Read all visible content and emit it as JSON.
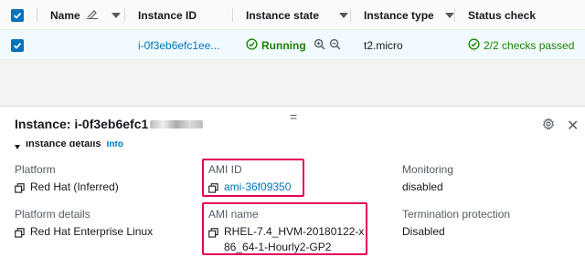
{
  "table": {
    "columns": {
      "name": "Name",
      "instance_id": "Instance ID",
      "instance_state": "Instance state",
      "instance_type": "Instance type",
      "status_check": "Status check"
    },
    "row": {
      "instance_id": "i-0f3eb6efc1ee...",
      "state": "Running",
      "type": "t2.micro",
      "status": "2/2 checks passed"
    }
  },
  "panel": {
    "title": "Instance: i-0f3eb6efc1",
    "drag_handle": "=",
    "section": "Instance details",
    "info_link": "Info",
    "close": "✕",
    "fields": {
      "platform_label": "Platform",
      "platform_value": "Red Hat (Inferred)",
      "ami_id_label": "AMI ID",
      "ami_id_value": "ami-36f09350",
      "monitoring_label": "Monitoring",
      "monitoring_value": "disabled",
      "platform_details_label": "Platform details",
      "platform_details_value": "Red Hat Enterprise Linux",
      "ami_name_label": "AMI name",
      "ami_name_value": "RHEL-7.4_HVM-20180122-x86_64-1-Hourly2-GP2",
      "termination_label": "Termination protection",
      "termination_value": "Disabled"
    }
  },
  "colors": {
    "accent": "#0073bb",
    "success": "#1d8102",
    "highlight": "#e4005a"
  },
  "icons": [
    "checkbox-checked-icon",
    "pencil-icon",
    "caret-down-icon",
    "zoom-in-icon",
    "zoom-out-icon",
    "check-circle-icon",
    "gear-icon",
    "close-icon",
    "copy-icon"
  ]
}
